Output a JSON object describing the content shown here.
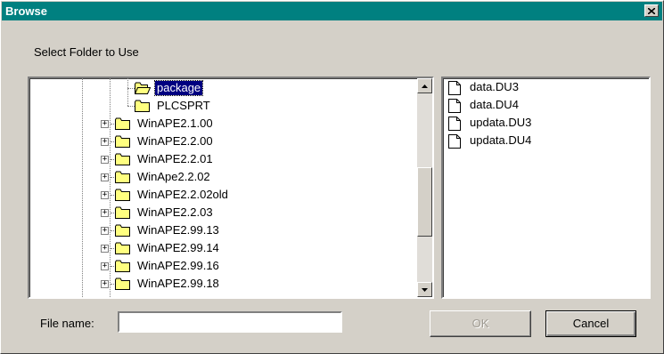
{
  "window": {
    "title": "Browse",
    "close_glyph": "✕"
  },
  "prompt": "Select Folder to Use",
  "tree": {
    "items": [
      {
        "label": "package",
        "expandable": false,
        "open": true,
        "selected": true
      },
      {
        "label": "PLCSPRT",
        "expandable": false,
        "open": false,
        "selected": false
      },
      {
        "label": "WinAPE2.1.00",
        "expandable": true,
        "open": false,
        "selected": false
      },
      {
        "label": "WinAPE2.2.00",
        "expandable": true,
        "open": false,
        "selected": false
      },
      {
        "label": "WinAPE2.2.01",
        "expandable": true,
        "open": false,
        "selected": false
      },
      {
        "label": "WinApe2.2.02",
        "expandable": true,
        "open": false,
        "selected": false
      },
      {
        "label": "WinAPE2.2.02old",
        "expandable": true,
        "open": false,
        "selected": false
      },
      {
        "label": "WinAPE2.2.03",
        "expandable": true,
        "open": false,
        "selected": false
      },
      {
        "label": "WinAPE2.99.13",
        "expandable": true,
        "open": false,
        "selected": false
      },
      {
        "label": "WinAPE2.99.14",
        "expandable": true,
        "open": false,
        "selected": false
      },
      {
        "label": "WinAPE2.99.16",
        "expandable": true,
        "open": false,
        "selected": false
      },
      {
        "label": "WinAPE2.99.18",
        "expandable": true,
        "open": false,
        "selected": false
      }
    ],
    "expander_glyph": "+",
    "scroll_position": 0.62
  },
  "files": {
    "items": [
      "data.DU3",
      "data.DU4",
      "updata.DU3",
      "updata.DU4"
    ]
  },
  "file_name": {
    "label": "File name:",
    "value": ""
  },
  "buttons": {
    "ok": "OK",
    "cancel": "Cancel",
    "ok_disabled": true
  },
  "icons": {
    "folder": "folder-icon",
    "document": "document-icon"
  },
  "colors": {
    "titlebar": "#008080",
    "selection": "#000080",
    "folder": "#ffff80"
  }
}
